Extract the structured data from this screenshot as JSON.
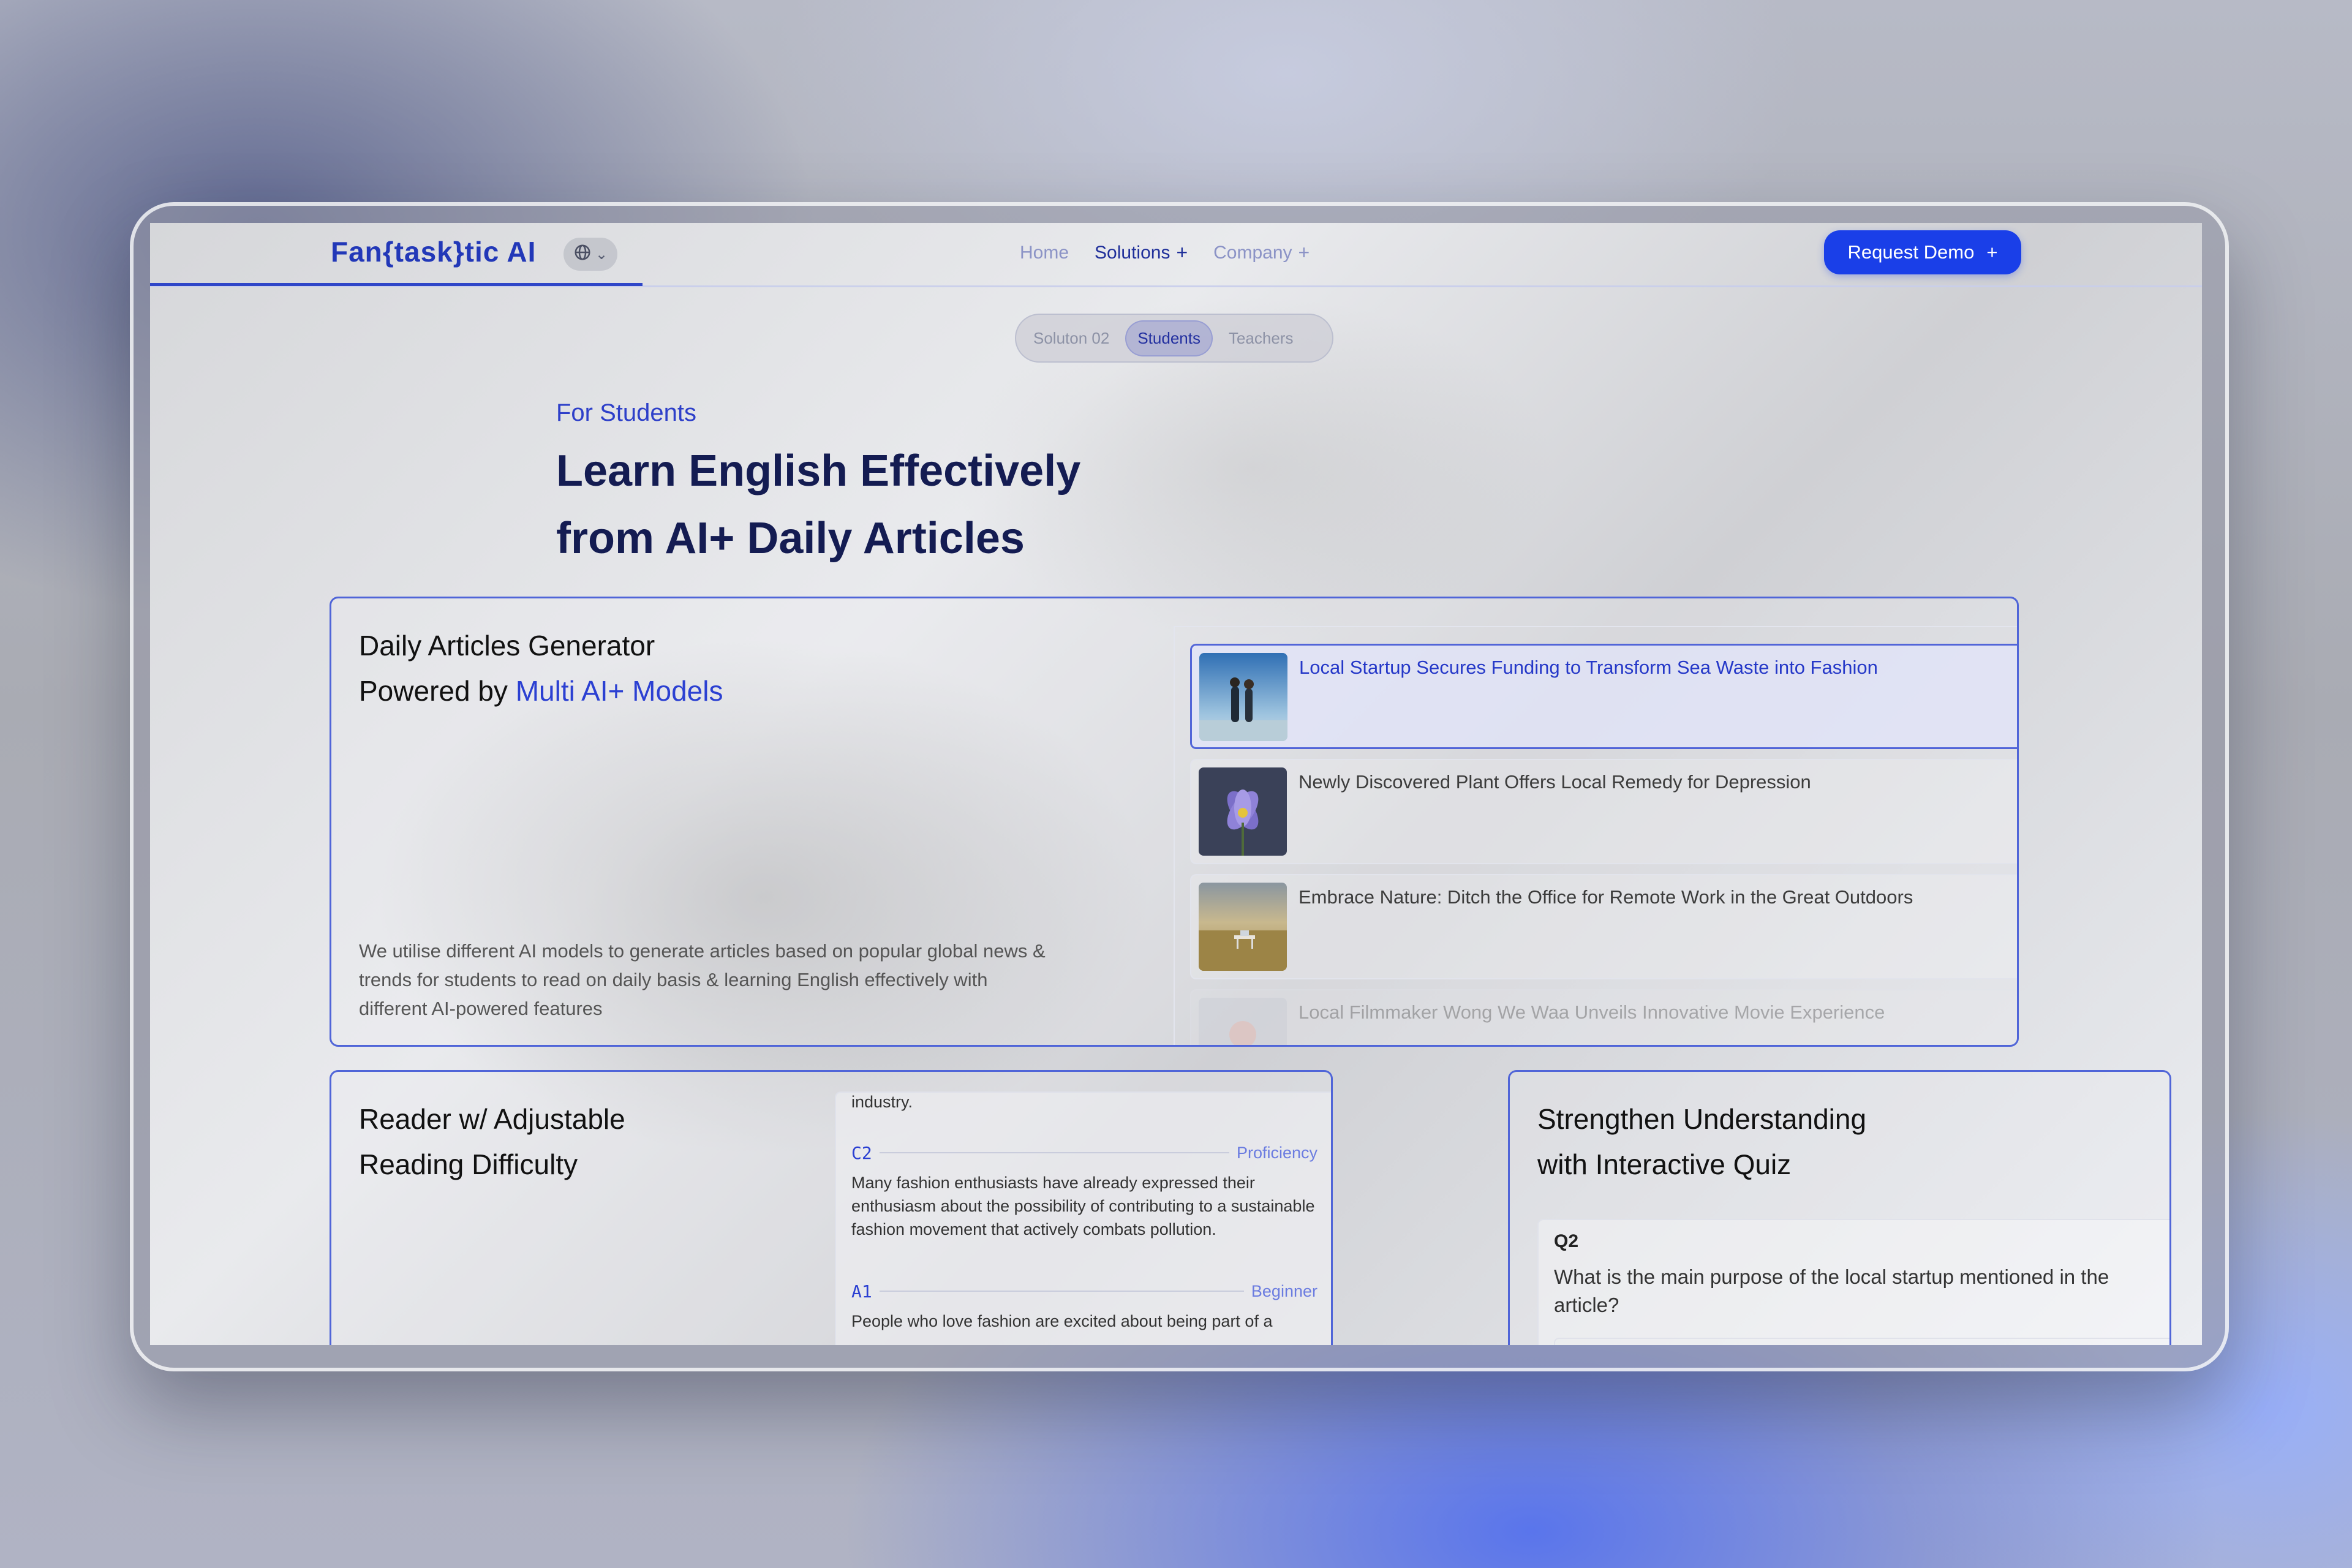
{
  "nav": {
    "logo": "Fan{task}tic AI",
    "lang_icon": "globe-icon",
    "links": [
      {
        "label": "Home",
        "plus": ""
      },
      {
        "label": "Solutions",
        "plus": "+"
      },
      {
        "label": "Company",
        "plus": "+"
      }
    ],
    "cta_label": "Request Demo",
    "cta_icon": "+"
  },
  "segments": [
    "Soluton 02",
    "Students",
    "Teachers"
  ],
  "hero": {
    "eyebrow": "For Students",
    "title_line1": "Learn English Effectively",
    "title_line2": "from AI+ Daily Articles"
  },
  "generator": {
    "title_line1": "Daily Articles Generator",
    "title_prefix": "Powered by ",
    "title_accent": "Multi AI+ Models",
    "description": "We utilise different AI models to generate articles based on popular global news & trends for students to read on daily basis & learning English effectively with different AI-powered features",
    "articles": [
      {
        "title": "Local Startup Secures Funding to Transform Sea Waste into Fashion"
      },
      {
        "title": "Newly Discovered Plant Offers Local Remedy for Depression"
      },
      {
        "title": "Embrace Nature: Ditch the Office for Remote Work in the Great Outdoors"
      },
      {
        "title": "Local Filmmaker Wong We Waa Unveils Innovative Movie Experience"
      }
    ]
  },
  "reader": {
    "title_line1": "Reader w/ Adjustable",
    "title_line2": "Reading Difficulty",
    "top_text": "industry.",
    "levels": [
      {
        "code": "C2",
        "name": "Proficiency",
        "text": "Many fashion enthusiasts have already expressed their enthusiasm about the possibility of contributing to a sustainable fashion movement that actively combats pollution."
      },
      {
        "code": "A1",
        "name": "Beginner",
        "text": "People who love fashion are excited about being part of a"
      }
    ]
  },
  "quiz": {
    "title_line1": "Strengthen Understanding",
    "title_line2": "with Interactive Quiz",
    "question_number": "Q2",
    "question_text": "What is the main purpose of the local startup mentioned in the article?"
  }
}
